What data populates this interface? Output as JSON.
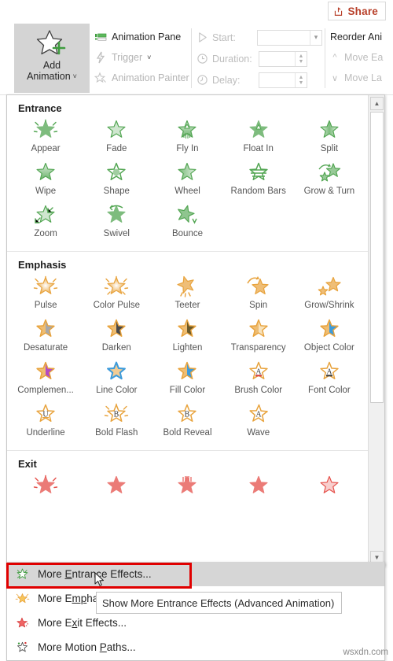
{
  "topbar": {
    "share_label": "Share",
    "share_icon": "share-icon"
  },
  "ribbon": {
    "add_animation": {
      "line1": "Add",
      "line2": "Animation",
      "caret": "˅",
      "icon": "star-plus-icon"
    },
    "commands": [
      {
        "label": "Animation Pane",
        "icon": "animation-pane-icon",
        "disabled": false
      },
      {
        "label": "Trigger",
        "icon": "lightning-icon",
        "caret": "˅",
        "disabled": true
      },
      {
        "label": "Animation Painter",
        "icon": "star-brush-icon",
        "disabled": true
      }
    ],
    "timing": [
      {
        "label": "Start:",
        "icon": "play-icon",
        "value": "",
        "control": "combo"
      },
      {
        "label": "Duration:",
        "icon": "clock-icon",
        "value": "",
        "control": "spinner"
      },
      {
        "label": "Delay:",
        "icon": "clock-delay-icon",
        "value": "",
        "control": "spinner"
      }
    ],
    "reorder": {
      "title": "Reorder Ani",
      "items": [
        {
          "label": "Move Ea",
          "icon": "chevron-up-icon"
        },
        {
          "label": "Move La",
          "icon": "chevron-down-icon"
        }
      ]
    }
  },
  "gallery": {
    "sections": [
      {
        "title": "Entrance",
        "color": "#53a653",
        "effects": [
          {
            "label": "Appear",
            "icon": "star-appear-icon"
          },
          {
            "label": "Fade",
            "icon": "star-fade-icon"
          },
          {
            "label": "Fly In",
            "icon": "star-flyin-icon"
          },
          {
            "label": "Float In",
            "icon": "star-floatin-icon"
          },
          {
            "label": "Split",
            "icon": "star-split-icon"
          },
          {
            "label": "Wipe",
            "icon": "star-wipe-icon"
          },
          {
            "label": "Shape",
            "icon": "star-shape-icon"
          },
          {
            "label": "Wheel",
            "icon": "star-wheel-icon"
          },
          {
            "label": "Random Bars",
            "icon": "star-randombars-icon"
          },
          {
            "label": "Grow & Turn",
            "icon": "star-growturn-icon"
          },
          {
            "label": "Zoom",
            "icon": "star-zoom-icon"
          },
          {
            "label": "Swivel",
            "icon": "star-swivel-icon"
          },
          {
            "label": "Bounce",
            "icon": "star-bounce-icon"
          }
        ]
      },
      {
        "title": "Emphasis",
        "color": "#e8a33d",
        "effects": [
          {
            "label": "Pulse",
            "icon": "star-pulse-icon"
          },
          {
            "label": "Color Pulse",
            "icon": "star-colorpulse-icon"
          },
          {
            "label": "Teeter",
            "icon": "star-teeter-icon"
          },
          {
            "label": "Spin",
            "icon": "star-spin-icon"
          },
          {
            "label": "Grow/Shrink",
            "icon": "star-growshrink-icon"
          },
          {
            "label": "Desaturate",
            "icon": "star-desaturate-icon"
          },
          {
            "label": "Darken",
            "icon": "star-darken-icon"
          },
          {
            "label": "Lighten",
            "icon": "star-lighten-icon"
          },
          {
            "label": "Transparency",
            "icon": "star-transparency-icon"
          },
          {
            "label": "Object Color",
            "icon": "star-objectcolor-icon"
          },
          {
            "label": "Complemen...",
            "icon": "star-complementary-icon"
          },
          {
            "label": "Line Color",
            "icon": "star-linecolor-icon"
          },
          {
            "label": "Fill Color",
            "icon": "star-fillcolor-icon"
          },
          {
            "label": "Brush Color",
            "icon": "star-brushcolor-icon"
          },
          {
            "label": "Font Color",
            "icon": "star-fontcolor-icon"
          },
          {
            "label": "Underline",
            "icon": "star-underline-icon"
          },
          {
            "label": "Bold Flash",
            "icon": "star-boldflash-icon"
          },
          {
            "label": "Bold Reveal",
            "icon": "star-boldreveal-icon"
          },
          {
            "label": "Wave",
            "icon": "star-wave-icon"
          }
        ]
      },
      {
        "title": "Exit",
        "color": "#e5504a",
        "effects": [
          {
            "label": "",
            "icon": "star-exit-disappear-icon"
          },
          {
            "label": "",
            "icon": "star-exit-fade-icon"
          },
          {
            "label": "",
            "icon": "star-exit-flyout-icon"
          },
          {
            "label": "",
            "icon": "star-exit-floatout-icon"
          },
          {
            "label": "",
            "icon": "star-exit-split-icon"
          }
        ]
      }
    ],
    "scrollbar": {
      "up": "▲",
      "down": "▼"
    }
  },
  "menu": {
    "items": [
      {
        "pre": "More ",
        "accel": "E",
        "post": "ntrance Effects...",
        "icon": "star-entrance-icon",
        "selected": true
      },
      {
        "pre": "More E",
        "accel": "mp",
        "post": "hasis Effects...",
        "icon": "star-emphasis-icon",
        "selected": false
      },
      {
        "pre": "More E",
        "accel": "x",
        "post": "it Effects...",
        "icon": "star-exit-icon",
        "selected": false
      },
      {
        "pre": "More Motion ",
        "accel": "P",
        "post": "aths...",
        "icon": "star-motionpath-icon",
        "selected": false
      }
    ]
  },
  "tooltip": {
    "text": "Show More Entrance Effects (Advanced Animation)"
  },
  "watermark": {
    "text": "wsxdn.com"
  },
  "colors": {
    "entrance": "#53a653",
    "emphasis": "#e8a33d",
    "exit": "#e5504a",
    "highlight": "#e00000",
    "selection": "#d6d6d6",
    "share": "#b8402a"
  }
}
